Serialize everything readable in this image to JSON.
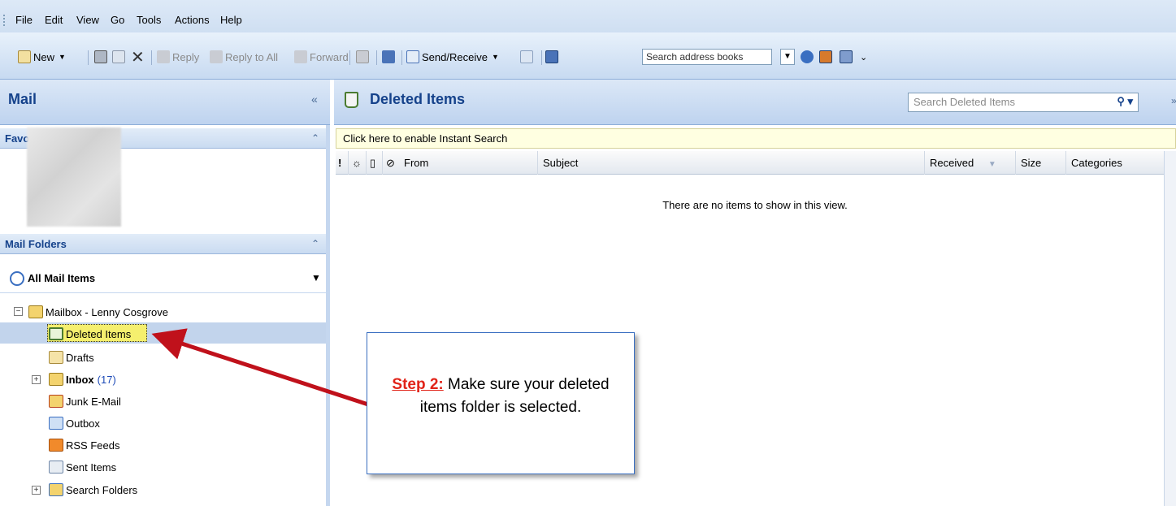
{
  "menu": [
    "File",
    "Edit",
    "View",
    "Go",
    "Tools",
    "Actions",
    "Help"
  ],
  "toolbar": {
    "new_label": "New",
    "reply_label": "Reply",
    "reply_all_label": "Reply to All",
    "forward_label": "Forward",
    "send_receive_label": "Send/Receive",
    "search_address_placeholder": "Search address books"
  },
  "nav": {
    "title": "Mail",
    "favorite_folders": "Favorite Folders",
    "mail_folders": "Mail Folders",
    "all_mail_items": "All Mail Items",
    "mailbox": "Mailbox - Lenny Cosgrove",
    "folders": [
      {
        "label": "Deleted Items"
      },
      {
        "label": "Drafts"
      },
      {
        "label": "Inbox",
        "count": "(17)"
      },
      {
        "label": "Junk E-Mail"
      },
      {
        "label": "Outbox"
      },
      {
        "label": "RSS Feeds"
      },
      {
        "label": "Sent Items"
      },
      {
        "label": "Search Folders"
      }
    ]
  },
  "content": {
    "title": "Deleted Items",
    "search_placeholder": "Search Deleted Items",
    "instant_search": "Click here to enable Instant Search",
    "columns": {
      "from": "From",
      "subject": "Subject",
      "received": "Received",
      "size": "Size",
      "categories": "Categories"
    },
    "empty_message": "There are no items to show in this view."
  },
  "callout": {
    "step": "Step 2:",
    "text": "Make sure your deleted items folder is selected."
  },
  "colors": {
    "accent": "#15428b",
    "arrow": "#c0111b",
    "step": "#e12318"
  }
}
